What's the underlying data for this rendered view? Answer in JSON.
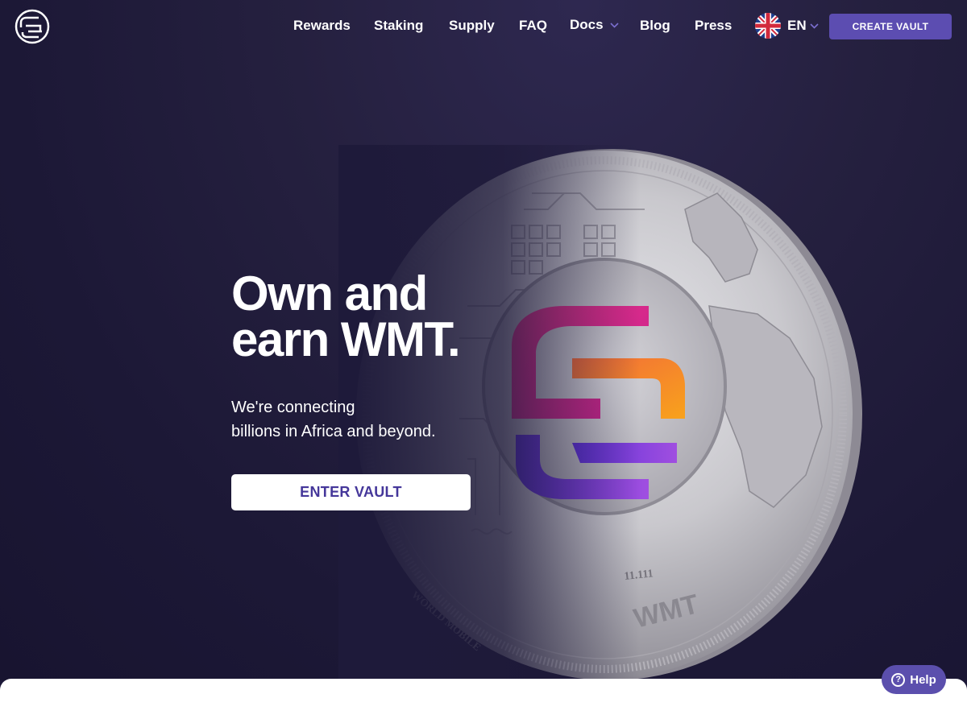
{
  "header": {
    "nav": [
      {
        "label": "Rewards"
      },
      {
        "label": "Staking"
      },
      {
        "label": "Supply"
      },
      {
        "label": "FAQ"
      },
      {
        "label": "Docs"
      },
      {
        "label": "Blog"
      },
      {
        "label": "Press"
      }
    ],
    "language": "EN",
    "create_vault": "CREATE VAULT"
  },
  "hero": {
    "headline_line1": "Own and",
    "headline_line2": "earn WMT.",
    "sub_line1": "We're connecting",
    "sub_line2": "billions in Africa and beyond.",
    "enter_vault": "ENTER VAULT"
  },
  "coin": {
    "denomination": "11.111",
    "ticker": "WMT",
    "rim_text": "WORLD MOBILE"
  },
  "help": {
    "label": "Help",
    "icon": "?"
  },
  "colors": {
    "accent": "#5c4db1",
    "background": "#1c1838",
    "button_text": "#45379a"
  }
}
